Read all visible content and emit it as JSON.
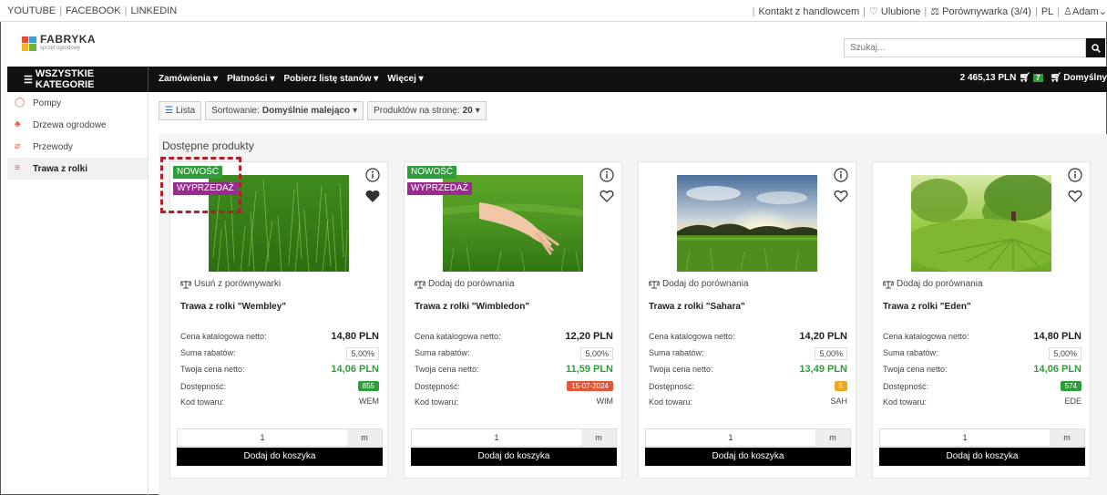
{
  "topbar": {
    "links": [
      "YOUTUBE",
      "FACEBOOK",
      "LINKEDIN"
    ],
    "contact": "Kontakt z handlowcem",
    "favorites": "Ulubione",
    "compare": "Porównywarka (3/4)",
    "lang": "PL",
    "user": "Adam"
  },
  "header": {
    "logo_name": "FABRYKA",
    "logo_sub": "sprzęt ogrodowy",
    "search_placeholder": "Szukaj..."
  },
  "nav": {
    "all_categories": "WSZYSTKIE KATEGORIE",
    "items": [
      "Zamówienia",
      "Płatności",
      "Pobierz listę stanów",
      "Więcej"
    ],
    "cart_total": "2 465,13 PLN",
    "cart_count": "7",
    "default_cart": "Domyślny"
  },
  "sidebar": {
    "items": [
      {
        "label": "Pompy",
        "icon": "pump-icon"
      },
      {
        "label": "Drzewa ogrodowe",
        "icon": "tree-icon"
      },
      {
        "label": "Przewody",
        "icon": "hose-icon"
      },
      {
        "label": "Trawa z rolki",
        "icon": "grass-icon",
        "active": true
      }
    ]
  },
  "toolbar": {
    "view": "Lista",
    "sort_label": "Sortowanie:",
    "sort_value": "Domyślnie malejąco",
    "per_page_label": "Produktów na stronę:",
    "per_page_value": "20"
  },
  "content": {
    "title": "Dostępne produkty"
  },
  "labels": {
    "catalog_price": "Cena katalogowa netto:",
    "discount_sum": "Suma rabatów:",
    "your_price": "Twoja cena netto:",
    "availability": "Dostępność:",
    "product_code": "Kod towaru:",
    "add_to_cart": "Dodaj do koszyka",
    "tag_new": "NOWOŚĆ",
    "tag_sale": "WYPRZEDAŻ"
  },
  "products": [
    {
      "name": "Trawa z rolki \"Wembley\"",
      "compare_action": "Usuń z porównywarki",
      "catalog_price": "14,80 PLN",
      "discount": "5,00%",
      "net_price": "14,06 PLN",
      "availability": "855",
      "availability_color": "#2e9e3a",
      "code": "WEM",
      "qty": "1",
      "unit": "m",
      "favorite": true,
      "tags": true
    },
    {
      "name": "Trawa z rolki \"Wimbledon\"",
      "compare_action": "Dodaj do porównania",
      "catalog_price": "12,20 PLN",
      "discount": "5,00%",
      "net_price": "11,59 PLN",
      "availability": "15-07-2024",
      "availability_color": "#e0573a",
      "code": "WIM",
      "qty": "1",
      "unit": "m",
      "favorite": false,
      "tags": true
    },
    {
      "name": "Trawa z rolki \"Sahara\"",
      "compare_action": "Dodaj do porównania",
      "catalog_price": "14,20 PLN",
      "discount": "5,00%",
      "net_price": "13,49 PLN",
      "availability": "5",
      "availability_color": "#f0a91e",
      "code": "SAH",
      "qty": "1",
      "unit": "m",
      "favorite": false,
      "tags": false
    },
    {
      "name": "Trawa z rolki \"Eden\"",
      "compare_action": "Dodaj do porównania",
      "catalog_price": "14,80 PLN",
      "discount": "5,00%",
      "net_price": "14,06 PLN",
      "availability": "574",
      "availability_color": "#2e9e3a",
      "code": "EDE",
      "qty": "1",
      "unit": "m",
      "favorite": false,
      "tags": false
    }
  ]
}
